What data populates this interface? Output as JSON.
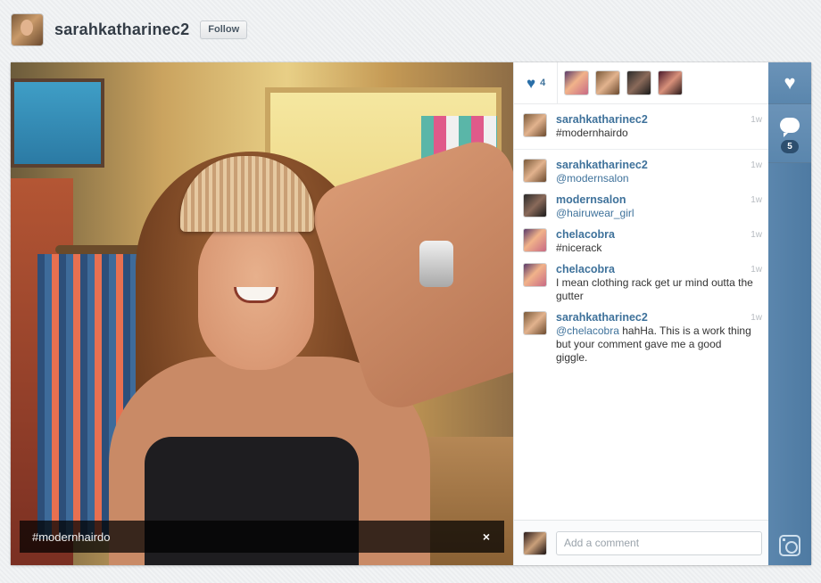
{
  "profile": {
    "username": "sarahkatharinec2",
    "follow_label": "Follow"
  },
  "post": {
    "caption": "#modernhairdo",
    "close_glyph": "×",
    "like_count": "4",
    "comment_count": "5"
  },
  "comments": [
    {
      "user": "sarahkatharinec2",
      "text": "#modernhairdo",
      "mention": "",
      "time": "1w"
    },
    {
      "user": "sarahkatharinec2",
      "text": "",
      "mention": "@modernsalon",
      "time": "1w"
    },
    {
      "user": "modernsalon",
      "text": "",
      "mention": "@hairuwear_girl",
      "time": "1w"
    },
    {
      "user": "chelacobra",
      "text": "#nicerack",
      "mention": "",
      "time": "1w"
    },
    {
      "user": "chelacobra",
      "text": "I mean clothing rack get ur mind outta the gutter",
      "mention": "",
      "time": "1w"
    },
    {
      "user": "sarahkatharinec2",
      "text": " hahHa. This is a work thing but your comment gave me a good giggle.",
      "mention": "@chelacobra",
      "time": "1w"
    }
  ],
  "comment_box": {
    "placeholder": "Add a comment"
  },
  "icons": {
    "like": "heart-icon",
    "comment": "comment-bubble-icon",
    "camera": "instagram-camera-icon",
    "close": "close-icon"
  },
  "colors": {
    "accent": "#3f729b",
    "rail": "#5a86ad"
  }
}
